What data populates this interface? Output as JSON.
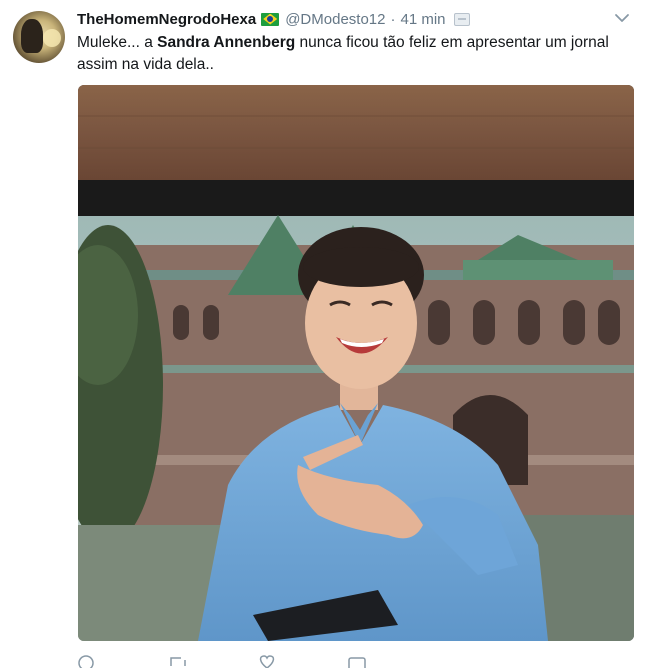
{
  "tweet": {
    "display_name": "TheHomemNegrodoHexa",
    "handle": "@DModesto12",
    "separator": "·",
    "time": "41 min",
    "text_prefix": "Muleke... a ",
    "text_bold": "Sandra Annenberg",
    "text_suffix": " nunca ficou tão feliz em apresentar um jornal assim na vida dela.."
  },
  "icons": {
    "flag": "brazil-flag-icon",
    "translate": "translate-icon",
    "caret": "chevron-down-icon",
    "reply": "reply-icon",
    "retweet": "retweet-icon",
    "like": "heart-icon",
    "dm": "direct-message-icon"
  },
  "colors": {
    "name": "#14171a",
    "secondary": "#657786",
    "icon": "#8899a6"
  }
}
